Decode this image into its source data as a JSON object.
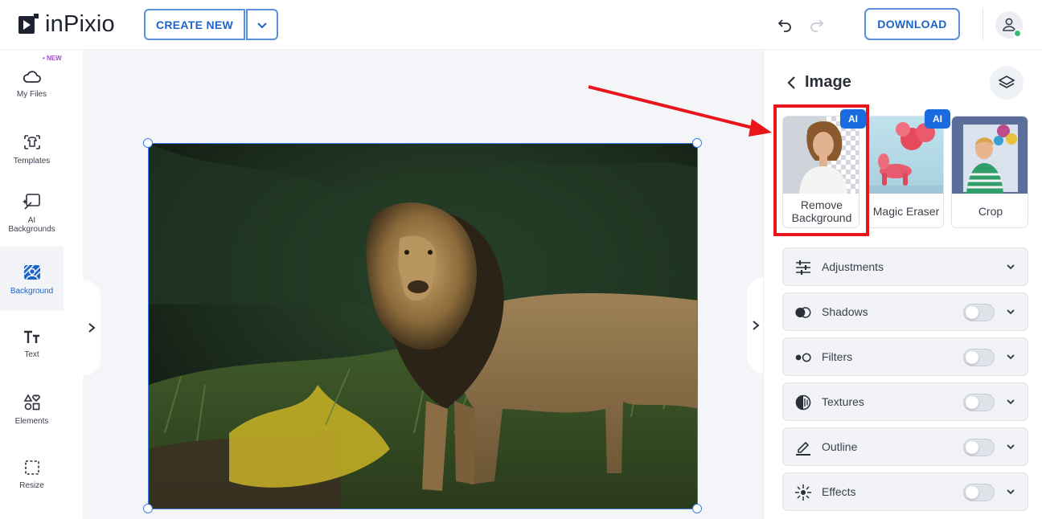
{
  "app": {
    "brand": "inPixio"
  },
  "toolbar": {
    "create_label": "CREATE NEW",
    "download_label": "DOWNLOAD"
  },
  "sidebar": {
    "new_badge": "NEW",
    "items": [
      {
        "label": "My Files",
        "icon": "cloud-icon"
      },
      {
        "label": "Templates",
        "icon": "shirt-icon"
      },
      {
        "label": "AI\nBackgrounds",
        "icon": "ai-background-icon"
      },
      {
        "label": "Background",
        "icon": "background-icon",
        "active": true
      },
      {
        "label": "Text",
        "icon": "text-icon"
      },
      {
        "label": "Elements",
        "icon": "shapes-icon"
      },
      {
        "label": "Resize",
        "icon": "resize-icon"
      }
    ]
  },
  "panel": {
    "title": "Image",
    "tools": [
      {
        "label": "Remove Background",
        "ai_badge": "AI"
      },
      {
        "label": "Magic Eraser",
        "ai_badge": "AI"
      },
      {
        "label": "Crop"
      }
    ],
    "sections": [
      {
        "label": "Adjustments",
        "icon": "sliders-icon",
        "toggle": false
      },
      {
        "label": "Shadows",
        "icon": "shadows-icon",
        "toggle": true,
        "on": false
      },
      {
        "label": "Filters",
        "icon": "filters-icon",
        "toggle": true,
        "on": false
      },
      {
        "label": "Textures",
        "icon": "textures-icon",
        "toggle": true,
        "on": false
      },
      {
        "label": "Outline",
        "icon": "outline-icon",
        "toggle": true,
        "on": false
      },
      {
        "label": "Effects",
        "icon": "effects-icon",
        "toggle": true,
        "on": false
      }
    ]
  },
  "colors": {
    "accent": "#1c64c8",
    "annotation": "#e8161b",
    "ai_badge": "#1a6be0"
  }
}
